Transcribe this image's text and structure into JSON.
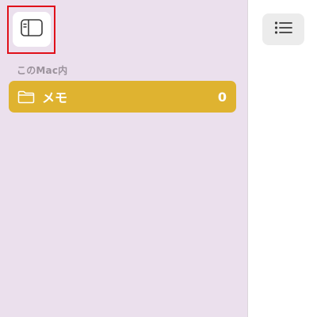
{
  "sidebar": {
    "toggle_icon": "sidebar-toggle-icon",
    "section_label": "このMac内",
    "folders": [
      {
        "label": "メモ",
        "count": "0",
        "icon": "folder-icon",
        "selected": true
      }
    ]
  },
  "toolbar": {
    "list_icon": "list-view-icon"
  },
  "colors": {
    "sidebar_bg": "#ebe0ed",
    "selection": "#dfb330",
    "highlight": "#e0101a"
  }
}
